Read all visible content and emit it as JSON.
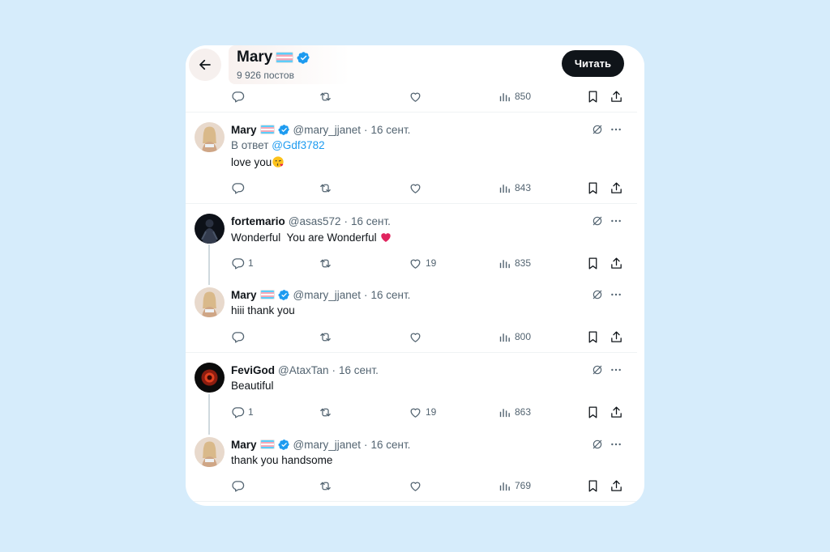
{
  "header": {
    "name": "Mary",
    "posts_count": "9 926 постов",
    "follow_label": "Читать"
  },
  "top_actions": {
    "views": "850"
  },
  "tweets": [
    {
      "name": "Mary",
      "handle": "@mary_jjanet",
      "dot": "·",
      "date": "16 сент.",
      "reply_prefix": "В ответ",
      "reply_to": "@Gdf3782",
      "text": "love you",
      "text_emoji": "kissing-face-with-heart-emoji",
      "replies": "",
      "likes": "",
      "views": "843"
    },
    {
      "name": "fortemario",
      "handle": "@asas572",
      "dot": "·",
      "date": "16 сент.",
      "text": "Wonderful  You are Wonderful",
      "text_emoji": "red-heart-emoji",
      "replies": "1",
      "likes": "19",
      "views": "835"
    },
    {
      "name": "Mary",
      "handle": "@mary_jjanet",
      "dot": "·",
      "date": "16 сент.",
      "text": "hiii thank you",
      "replies": "",
      "likes": "",
      "views": "800"
    },
    {
      "name": "FeviGod",
      "handle": "@AtaxTan",
      "dot": "·",
      "date": "16 сент.",
      "text": "Beautiful",
      "replies": "1",
      "likes": "19",
      "views": "863"
    },
    {
      "name": "Mary",
      "handle": "@mary_jjanet",
      "dot": "·",
      "date": "16 сент.",
      "text": "thank you handsome",
      "replies": "",
      "likes": "",
      "views": "769"
    }
  ],
  "icons": {
    "back": "arrow-left-icon",
    "verified": "verified-badge-icon",
    "flag": "transgender-flag-emoji",
    "reply": "reply-icon",
    "retweet": "retweet-icon",
    "like": "heart-icon",
    "views": "views-chart-icon",
    "bookmark": "bookmark-icon",
    "share": "share-icon",
    "grok": "grok-icon",
    "more": "more-icon"
  },
  "colors": {
    "background": "#d6ecfb",
    "accent": "#1d9bf0",
    "text": "#0f1419",
    "muted": "#536471",
    "button": "#0f1419"
  }
}
